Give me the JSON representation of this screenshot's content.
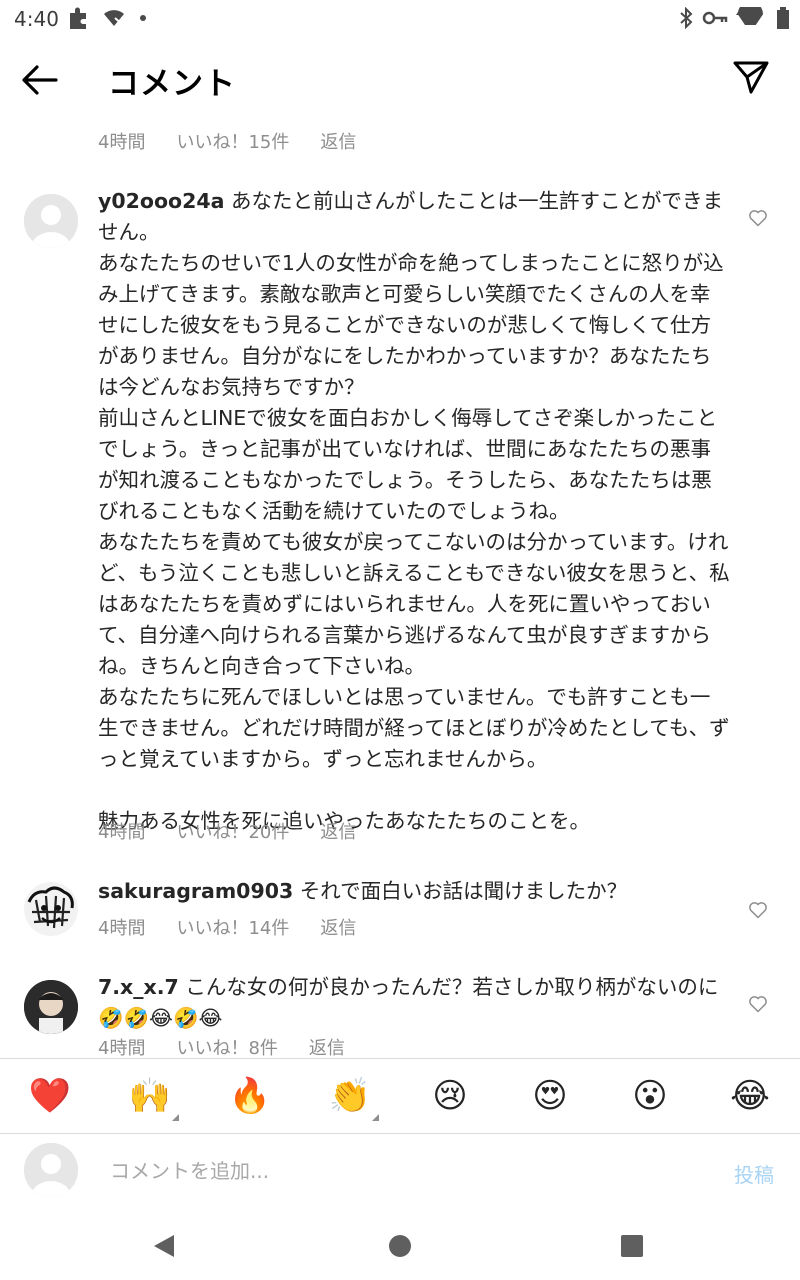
{
  "status_bar": {
    "time": "4:40",
    "icons_left": [
      "puzzle-icon",
      "wifi-icon",
      "dot-icon"
    ],
    "icons_right": [
      "bluetooth-icon",
      "key-icon",
      "signal-icon",
      "battery-icon"
    ]
  },
  "header": {
    "title": "コメント",
    "back_icon": "arrow-left-icon",
    "send_icon": "paper-plane-icon"
  },
  "top_meta": {
    "time": "4時間",
    "likes": "いいね！15件",
    "reply": "返信"
  },
  "comments": [
    {
      "username": "y02ooo24a",
      "text": " あなたと前山さんがしたことは一生許すことができません。\nあなたたちのせいで1人の女性が命を絶ってしまったことに怒りが込み上げてきます。素敵な歌声と可愛らしい笑顔でたくさんの人を幸せにした彼女をもう見ることができないのが悲しくて悔しくて仕方がありません。自分がなにをしたかわかっていますか？あなたたちは今どんなお気持ちですか？\n前山さんとLINEで彼女を面白おかしく侮辱してさぞ楽しかったことでしょう。きっと記事が出ていなければ、世間にあなたたちの悪事が知れ渡ることもなかったでしょう。そうしたら、あなたたちは悪びれることもなく活動を続けていたのでしょうね。\nあなたたちを責めても彼女が戻ってこないのは分かっています。けれど、もう泣くことも悲しいと訴えることもできない彼女を思うと、私はあなたたちを責めずにはいられません。人を死に置いやっておいて、自分達へ向けられる言葉から逃げるなんて虫が良すぎますからね。きちんと向き合って下さいね。\nあなたたちに死んでほしいとは思っていません。でも許すことも一生できません。どれだけ時間が経ってほとぼりが冷めたとしても、ずっと覚えていますから。ずっと忘れませんから。\n\n魅力ある女性を死に追いやったあなたたちのことを。",
      "time": "4時間",
      "likes": "いいね！20件",
      "reply": "返信",
      "avatar": "default-avatar"
    },
    {
      "username": "sakuragram0903",
      "text": " それで面白いお話は聞けましたか？",
      "time": "4時間",
      "likes": "いいね！14件",
      "reply": "返信",
      "avatar": "sketch-avatar"
    },
    {
      "username": "7.x_x.7",
      "text": " こんな女の何が良かったんだ？若さしか取り柄がないのに🤣🤣😂🤣😂",
      "time": "4時間",
      "likes": "いいね！8件",
      "reply": "返信",
      "avatar": "photo-avatar"
    }
  ],
  "reactions": [
    "❤️",
    "🙌",
    "🔥",
    "👏",
    "😢",
    "😍",
    "😮",
    "😂"
  ],
  "input": {
    "placeholder": "コメントを追加...",
    "post_label": "投稿"
  },
  "nav": [
    "back-triangle-icon",
    "home-circle-icon",
    "recents-square-icon"
  ],
  "colors": {
    "meta": "#8e8e8e",
    "post": "#a7d3f5",
    "divider": "#dbdbdb"
  }
}
